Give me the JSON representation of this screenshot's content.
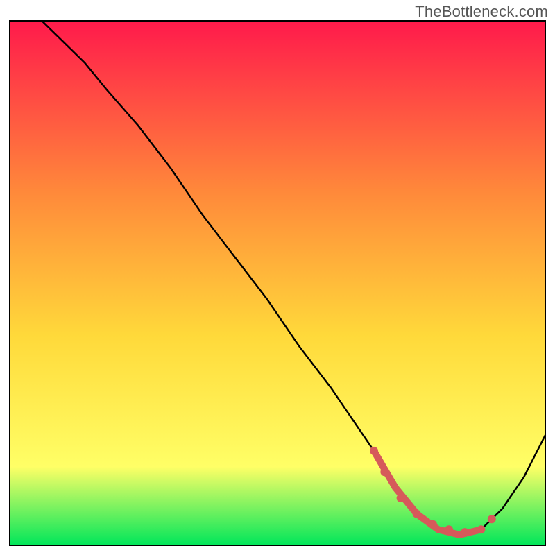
{
  "watermark": "TheBottleneck.com",
  "colors": {
    "gradient_top": "#ff1a4b",
    "gradient_mid1": "#ff8a3a",
    "gradient_mid2": "#ffd93a",
    "gradient_mid3": "#ffff66",
    "gradient_bottom": "#00e65a",
    "curve": "#000000",
    "marker": "#d65a5a"
  },
  "chart_data": {
    "type": "line",
    "title": "",
    "xlabel": "",
    "ylabel": "",
    "xlim": [
      0,
      100
    ],
    "ylim": [
      0,
      100
    ],
    "grid": false,
    "legend": false,
    "series": [
      {
        "name": "main-curve",
        "x": [
          6,
          10,
          14,
          18,
          24,
          30,
          36,
          42,
          48,
          54,
          60,
          64,
          68,
          72,
          76,
          80,
          84,
          88,
          92,
          96,
          100
        ],
        "y": [
          100,
          96,
          92,
          87,
          80,
          72,
          63,
          55,
          47,
          38,
          30,
          24,
          18,
          11,
          6,
          3,
          2,
          3,
          7,
          13,
          21
        ]
      },
      {
        "name": "highlight-segment",
        "x": [
          68,
          72,
          76,
          80,
          84,
          88
        ],
        "y": [
          18,
          11,
          6,
          3,
          2,
          3
        ]
      }
    ],
    "markers": [
      {
        "x": 68,
        "y": 18
      },
      {
        "x": 70,
        "y": 14
      },
      {
        "x": 73,
        "y": 9
      },
      {
        "x": 76,
        "y": 6
      },
      {
        "x": 79,
        "y": 4
      },
      {
        "x": 82,
        "y": 3
      },
      {
        "x": 85,
        "y": 2.5
      },
      {
        "x": 88,
        "y": 3
      },
      {
        "x": 90,
        "y": 5
      }
    ]
  }
}
